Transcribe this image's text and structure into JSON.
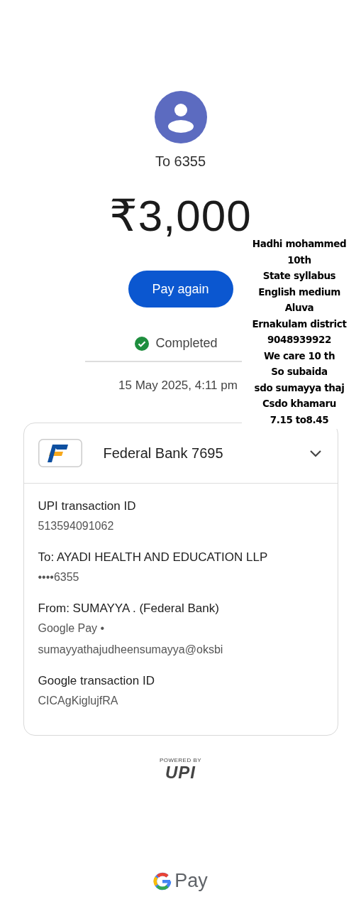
{
  "payee": {
    "title": "To 6355"
  },
  "amount": "₹3,000",
  "pay_again": "Pay again",
  "status": {
    "label": "Completed",
    "completed": true
  },
  "date": "15 May 2025, 4:11 pm",
  "note_lines": [
    "Hadhi mohammed",
    "10th",
    "State syllabus",
    "English medium",
    "Aluva",
    "Ernakulam district",
    "9048939922",
    "We care 10 th",
    "So subaida",
    "sdo sumayya thaj",
    "Csdo khamaru",
    "7.15 to8.45"
  ],
  "account": {
    "name": "Federal Bank 7695",
    "expanded": true
  },
  "details": [
    {
      "label": "UPI transaction ID",
      "lines": [
        "513594091062"
      ]
    },
    {
      "label": "To: AYADI HEALTH AND EDUCATION LLP",
      "lines": [
        "••••6355"
      ]
    },
    {
      "label": "From: SUMAYYA . (Federal Bank)",
      "lines": [
        "Google Pay •",
        "sumayyathajudheensumayya@oksbi"
      ]
    },
    {
      "label": "Google transaction ID",
      "lines": [
        "CICAgKiglujfRA"
      ]
    }
  ],
  "upi_badge": {
    "caption": "POWERED BY",
    "logo": "UPI"
  },
  "footer_brand": "Pay"
}
